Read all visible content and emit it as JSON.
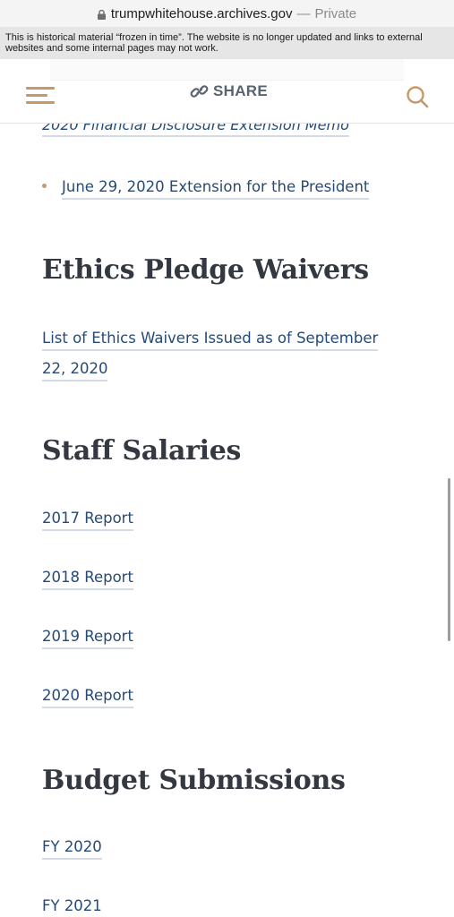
{
  "browser": {
    "url": "trumpwhitehouse.archives.gov",
    "separator": "—",
    "mode": "Private"
  },
  "notice": {
    "text": "This is historical material “frozen in time”. The website is no longer updated and links to external websites and some internal pages may not work."
  },
  "header": {
    "share_label": "SHARE",
    "icons": [
      "menu-icon",
      "link-icon",
      "search-icon"
    ],
    "accent_color": "#c59a6a"
  },
  "content": {
    "partial_link": "2020 Financial Disclosure Extension Memo",
    "bullet_link": "June 29, 2020 Extension for the President",
    "sections": [
      {
        "title": "Ethics Pledge Waivers",
        "links": [
          "List of Ethics Waivers Issued as of September 22, 2020"
        ]
      },
      {
        "title": "Staff Salaries",
        "links": [
          "2017 Report",
          "2018 Report",
          "2019 Report",
          "2020 Report"
        ]
      },
      {
        "title": "Budget Submissions",
        "links": [
          "FY 2020",
          "FY 2021"
        ]
      }
    ]
  },
  "colors": {
    "link": "#264a77",
    "heading": "#333841",
    "underline": "#d4dbe4"
  }
}
